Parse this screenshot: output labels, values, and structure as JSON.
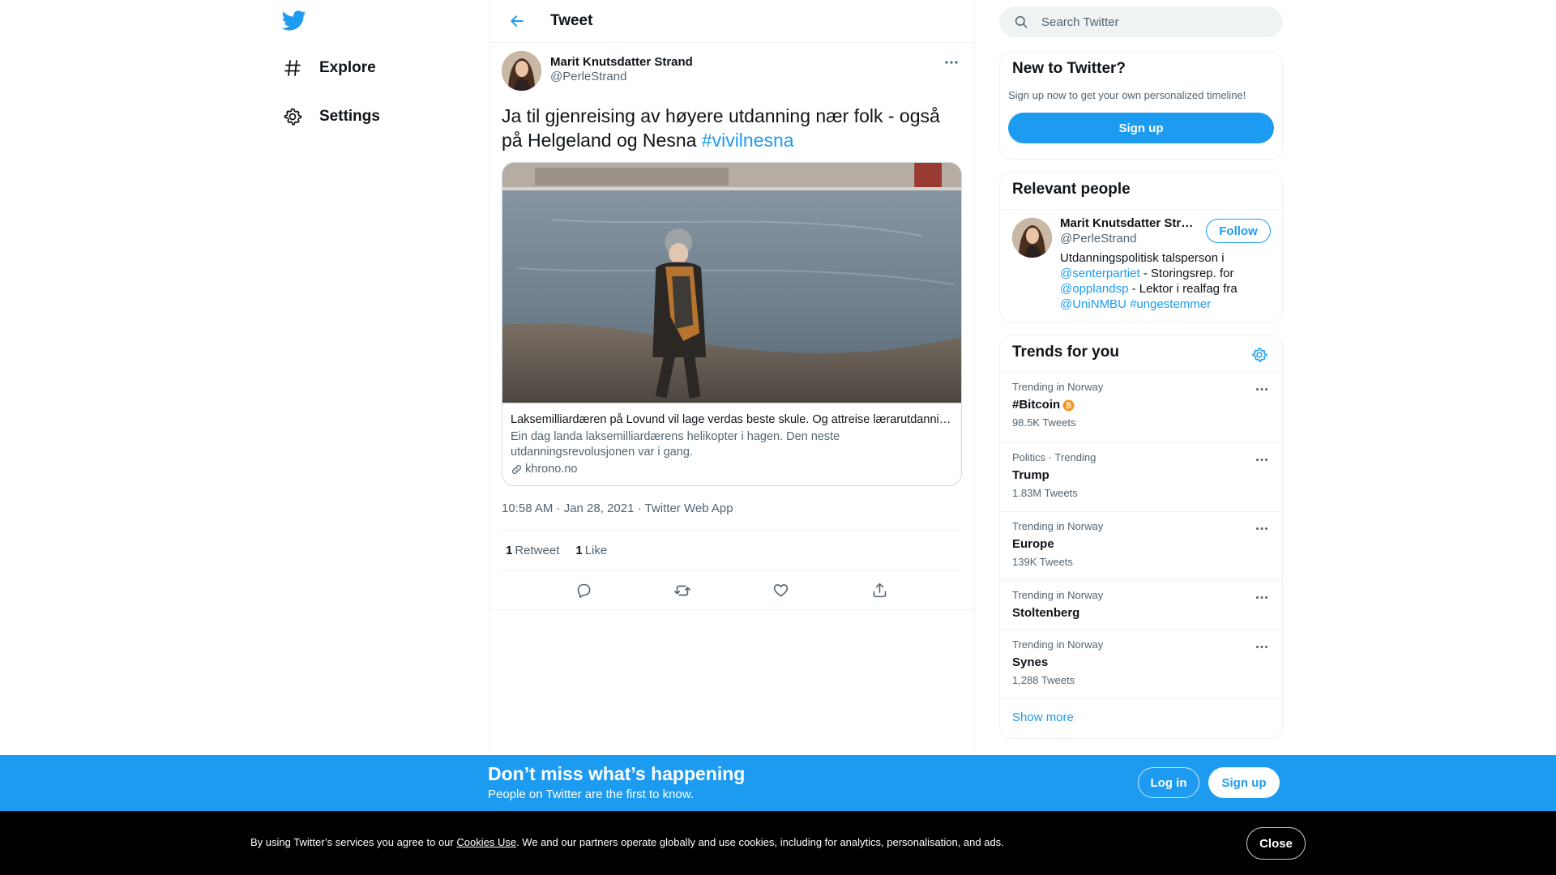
{
  "nav": {
    "logo_icon": "twitter-bird-icon",
    "items": [
      {
        "label": "Explore",
        "icon": "hashtag-icon"
      },
      {
        "label": "Settings",
        "icon": "gear-icon"
      }
    ]
  },
  "header": {
    "title": "Tweet",
    "back_icon": "arrow-left-icon"
  },
  "tweet": {
    "author_name": "Marit Knutsdatter Strand",
    "author_handle": "@PerleStrand",
    "text": "Ja til gjenreising av høyere utdanning nær folk - også på Helgeland og Nesna ",
    "hashtag": "#vivilnesna",
    "card": {
      "title": "Laksemilliardæren på Lovund vil lage verdas beste skule. Og attreise lærarutdanninga på Nesna",
      "description": "Ein dag landa laksemilliardærens helikopter i hagen. Den neste utdanningsrevolusjonen var i gang.",
      "domain": "khrono.no"
    },
    "time": "10:58 AM · Jan 28, 2021 ·",
    "app": "Twitter Web App",
    "retweets_count": "1",
    "retweets_label": "Retweet",
    "likes_count": "1",
    "likes_label": "Like"
  },
  "search": {
    "placeholder": "Search Twitter"
  },
  "new_to_twitter": {
    "title": "New to Twitter?",
    "subtitle": "Sign up now to get your own personalized timeline!",
    "signup_label": "Sign up"
  },
  "relevant_people": {
    "title": "Relevant people",
    "person": {
      "name": "Marit Knutsdatter Strand",
      "handle": "@PerleStrand",
      "follow_label": "Follow",
      "bio_1": "Utdanningspolitisk talsperson i ",
      "mention_1": "@senterpartiet",
      "bio_2": " - Storingsrep. for ",
      "mention_2": "@opplandsp",
      "bio_3": " - Lektor i realfag fra ",
      "mention_3": "@UniNMBU",
      "bio_4": " ",
      "mention_4": "#ungestemmer"
    }
  },
  "trends": {
    "title": "Trends for you",
    "items": [
      {
        "context": "Trending in Norway",
        "name": "#Bitcoin",
        "count": "98.5K Tweets",
        "emoji": "bitcoin-icon"
      },
      {
        "context": "Politics · Trending",
        "name": "Trump",
        "count": "1.83M Tweets"
      },
      {
        "context": "Trending in Norway",
        "name": "Europe",
        "count": "139K Tweets"
      },
      {
        "context": "Trending in Norway",
        "name": "Stoltenberg",
        "count": ""
      },
      {
        "context": "Trending in Norway",
        "name": "Synes",
        "count": "1,288 Tweets"
      }
    ],
    "show_more": "Show more"
  },
  "banner": {
    "title": "Don’t miss what’s happening",
    "subtitle": "People on Twitter are the first to know.",
    "login_label": "Log in",
    "signup_label": "Sign up"
  },
  "cookie": {
    "text_before": "By using Twitter’s services you agree to our ",
    "link": "Cookies Use",
    "text_after": ". We and our partners operate globally and use cookies, including for analytics, personalisation, and ads.",
    "close_label": "Close"
  },
  "colors": {
    "accent": "#1d9bf0",
    "text": "#0f1419",
    "secondary": "#536471",
    "border": "#eff3f4",
    "cookie_bg": "#000000"
  }
}
